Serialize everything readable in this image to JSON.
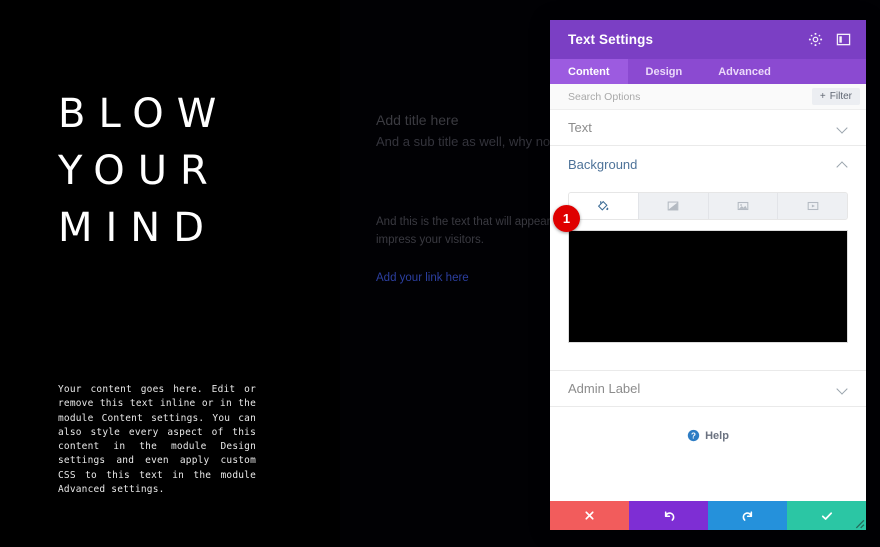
{
  "canvas": {
    "headline": {
      "lines": [
        "BLOW",
        "YOUR",
        "MIND"
      ]
    },
    "title_module": {
      "title": "Add title here",
      "subtitle": "And a sub title as well, why not"
    },
    "paragraph": "And this is the text that will appear as a paragraph to impress your visitors.",
    "link_text": "Add your link here",
    "mono_text": "Your content goes here. Edit or remove this text inline or in the module Content settings. You can also style every aspect of this content in the module Design settings and even apply custom CSS to this text in the module Advanced settings."
  },
  "panel": {
    "title": "Text Settings",
    "header_icons": [
      {
        "name": "target-icon"
      },
      {
        "name": "layout-panel-icon"
      }
    ],
    "tabs": [
      {
        "label": "Content",
        "active": true
      },
      {
        "label": "Design",
        "active": false
      },
      {
        "label": "Advanced",
        "active": false
      }
    ],
    "search": {
      "placeholder": "Search Options",
      "value": "",
      "filter_label": "Filter"
    },
    "sections": [
      {
        "label": "Text",
        "open": false
      },
      {
        "label": "Background",
        "open": true
      },
      {
        "label": "Admin Label",
        "open": false
      }
    ],
    "background": {
      "types": [
        {
          "name": "color-fill-icon",
          "label": "Color",
          "active": true
        },
        {
          "name": "gradient-icon",
          "label": "Gradient",
          "active": false
        },
        {
          "name": "image-icon",
          "label": "Image",
          "active": false
        },
        {
          "name": "video-icon",
          "label": "Video",
          "active": false
        }
      ],
      "swatch_color": "#000000"
    },
    "help_label": "Help",
    "footer_actions": [
      {
        "name": "close-button",
        "icon": "cross-icon",
        "color": "#F25C5C"
      },
      {
        "name": "undo-button",
        "icon": "undo-arrow-icon",
        "color": "#7E2ED4"
      },
      {
        "name": "redo-button",
        "icon": "redo-arrow-icon",
        "color": "#2591DB"
      },
      {
        "name": "save-button",
        "icon": "check-icon",
        "color": "#2BC6A4"
      }
    ]
  },
  "markers": {
    "one": "1"
  },
  "colors": {
    "panel_header": "#7B3FC4",
    "panel_tabbar": "#8B4AD1",
    "tab_active": "#9C5BE0",
    "marker_red": "#DF0000",
    "link_blue": "#2C3FA0",
    "section_open": "#4E7399"
  }
}
